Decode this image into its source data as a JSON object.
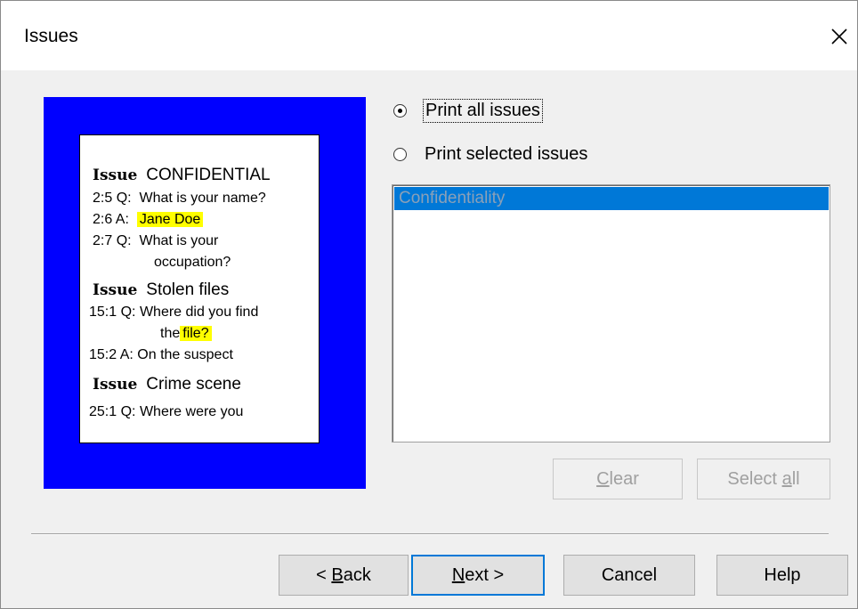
{
  "window": {
    "title": "Issues",
    "close_icon": "close-icon"
  },
  "preview": {
    "background_color": "#0000ff",
    "highlight_color": "#ffff00",
    "issue_word": "Issue",
    "issues": [
      {
        "title": "CONFIDENTIAL"
      },
      {
        "title": "Stolen files"
      },
      {
        "title": "Crime scene"
      }
    ],
    "lines": {
      "l1_ref": "2:5 Q:",
      "l1_text": "What is your name?",
      "l2_ref": "2:6 A:",
      "l2_text": "Jane Doe",
      "l3_ref": "2:7 Q:",
      "l3_text": "What is your",
      "l3b_text": "occupation?",
      "l4_ref": "15:1 Q:",
      "l4_text": "Where did you find",
      "l4b_pre": "the",
      "l4b_hl": "file?",
      "l5_ref": "15:2 A:",
      "l5_text": "On the suspect",
      "l6_ref": "25:1 Q:",
      "l6_text": "Where were you"
    }
  },
  "options": {
    "print_all": {
      "label": "Print all issues",
      "checked": true
    },
    "print_selected": {
      "label": "Print selected issues",
      "checked": false
    }
  },
  "issue_list": {
    "items": [
      "Confidentiality"
    ],
    "selected_index": 0
  },
  "list_buttons": {
    "clear": {
      "pre": "",
      "accel": "C",
      "post": "lear"
    },
    "select_all": {
      "pre": "Select ",
      "accel": "a",
      "post": "ll"
    }
  },
  "footer_buttons": {
    "back": {
      "pre": "< ",
      "accel": "B",
      "post": "ack"
    },
    "next": {
      "pre": "",
      "accel": "N",
      "post": "ext >"
    },
    "cancel": "Cancel",
    "help": "Help"
  }
}
